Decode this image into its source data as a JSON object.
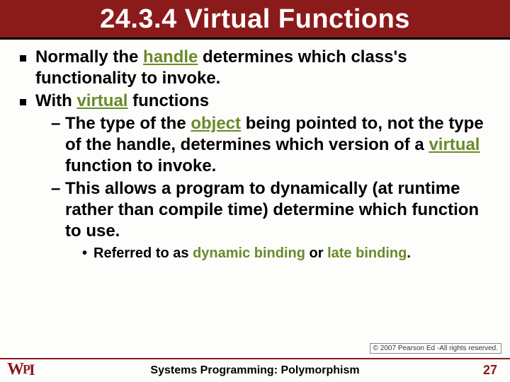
{
  "title": "24.3.4 Virtual Functions",
  "bullet1": {
    "pre": "Normally the ",
    "kw": "handle",
    "post": " determines which class's functionality to invoke."
  },
  "bullet2": {
    "pre": "With ",
    "kw": "virtual",
    "post": " functions"
  },
  "sub1": {
    "p1": "The type of the ",
    "kw1": "object",
    "p2": " being pointed to, not the type of the handle, determines which version of a ",
    "kw2": "virtual",
    "p3": " function to invoke."
  },
  "sub2": "This allows a program to dynamically (at runtime rather than compile time) determine which function to use.",
  "subsub": {
    "pre": "Referred to as ",
    "kw1": "dynamic binding",
    "mid": " or ",
    "kw2": "late binding",
    "post": "."
  },
  "copyright": "© 2007 Pearson Ed -All rights reserved.",
  "footer_title": "Systems Programming:  Polymorphism",
  "page_num": "27",
  "logo": {
    "w": "W",
    "p": "P",
    "i": "I"
  }
}
